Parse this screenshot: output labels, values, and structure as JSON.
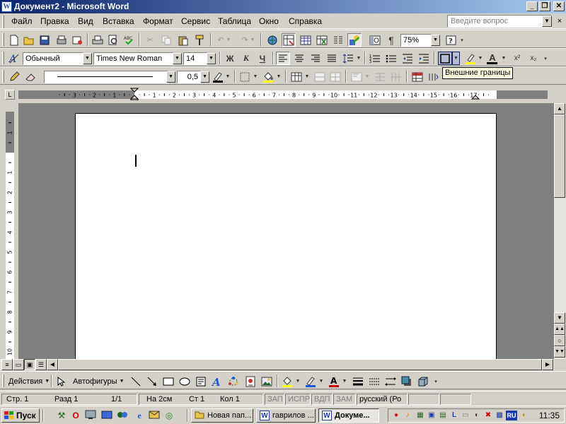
{
  "window": {
    "title": "Документ2 - Microsoft Word",
    "title_icon": "W",
    "controls": {
      "minimize": "_",
      "restore": "❐",
      "close": "✕"
    }
  },
  "menubar": {
    "items": [
      "Файл",
      "Правка",
      "Вид",
      "Вставка",
      "Формат",
      "Сервис",
      "Таблица",
      "Окно",
      "Справка"
    ],
    "help_placeholder": "Введите вопрос",
    "close": "×"
  },
  "standard_toolbar": {
    "zoom": "75%"
  },
  "formatting_toolbar": {
    "style": "Обычный",
    "font": "Times New Roman",
    "size": "14",
    "bold": "Ж",
    "italic": "К",
    "underline": "Ч",
    "font_color_letter": "A",
    "superscript": "x²",
    "subscript": "x₂"
  },
  "tables_toolbar": {
    "line_weight": "0,5"
  },
  "tooltip": "Внешние границы",
  "rulers": {
    "corner_symbol": "L",
    "h_ticks": [
      "3",
      "2",
      "1",
      "1",
      "2",
      "3",
      "4",
      "5",
      "6",
      "7",
      "8",
      "9",
      "10",
      "11",
      "12",
      "13",
      "14",
      "15",
      "16",
      "17"
    ],
    "v_ticks": [
      "2",
      "1",
      "1",
      "2",
      "3",
      "4",
      "5",
      "6",
      "7",
      "8",
      "9",
      "10"
    ]
  },
  "drawing_toolbar": {
    "actions": "Действия",
    "autoshapes": "Автофигуры"
  },
  "statusbar": {
    "page": "Стр. 1",
    "section": "Разд 1",
    "pages": "1/1",
    "at": "На 2см",
    "line": "Ст 1",
    "col": "Кол 1",
    "rec": "ЗАП",
    "trk": "ИСПР",
    "ext": "ВДП",
    "ovr": "ЗАМ",
    "language": "русский (Ро"
  },
  "taskbar": {
    "start": "Пуск",
    "tasks": [
      {
        "label": "Новая пап...",
        "icon": "folder-icon",
        "active": false
      },
      {
        "label": "гаврилов ...",
        "icon": "word-doc-icon",
        "active": false
      },
      {
        "label": "Докуме...",
        "icon": "word-doc-icon",
        "active": true
      }
    ],
    "tray_lang": "RU",
    "clock": "11:35"
  }
}
